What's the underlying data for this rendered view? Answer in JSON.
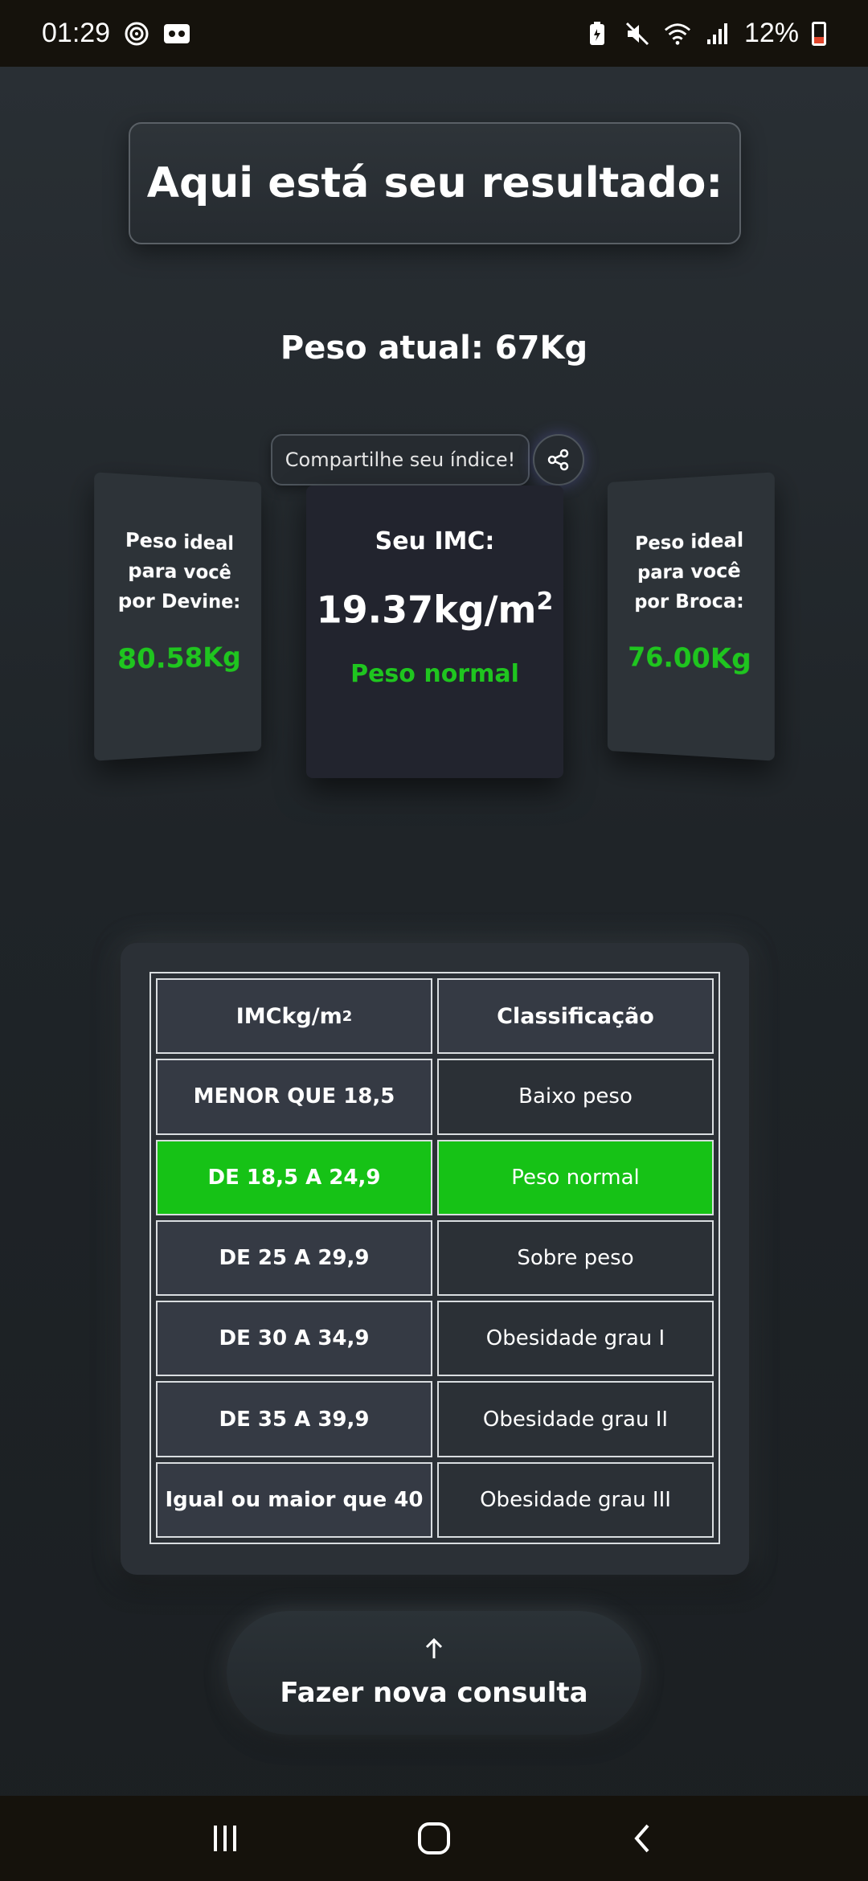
{
  "status_bar": {
    "time": "01:29",
    "battery": "12%",
    "icons": [
      "fingerprint-icon",
      "voicemail-icon",
      "battery-saver-icon",
      "mute-icon",
      "wifi-icon",
      "signal-icon",
      "battery-icon"
    ]
  },
  "header": {
    "title": "Aqui está seu resultado:"
  },
  "current_weight": "Peso atual: 67Kg",
  "share": {
    "label": "Compartilhe seu índice!",
    "icon": "share-icon"
  },
  "cards": {
    "left": {
      "label": "Peso ideal para você por Devine:",
      "value": "80.58Kg"
    },
    "center": {
      "label": "Seu IMC:",
      "value": "19.37kg/m",
      "value_exponent": "2",
      "classification": "Peso normal"
    },
    "right": {
      "label": "Peso ideal para você por Broca:",
      "value": "76.00Kg"
    }
  },
  "table": {
    "header": {
      "col1": "IMCkg/m",
      "col1_exponent": "2",
      "col2": "Classificação"
    },
    "rows": [
      {
        "range": "MENOR QUE 18,5",
        "class": "Baixo peso"
      },
      {
        "range": "DE 18,5 A 24,9",
        "class": "Peso normal"
      },
      {
        "range": "DE 25 A 29,9",
        "class": "Sobre peso"
      },
      {
        "range": "DE 30 A 34,9",
        "class": "Obesidade grau I"
      },
      {
        "range": "DE 35 A 39,9",
        "class": "Obesidade grau II"
      },
      {
        "range": "Igual ou maior que 40",
        "class": "Obesidade grau III"
      }
    ],
    "highlight_color": "#16c216"
  },
  "new_query_button": {
    "label": "Fazer nova consulta",
    "icon": "arrow-up-icon"
  },
  "colors": {
    "accent_green": "#1fc51f",
    "background": "#1f2428"
  },
  "nav_bar": {
    "icons": [
      "recents-icon",
      "home-icon",
      "back-icon"
    ]
  }
}
